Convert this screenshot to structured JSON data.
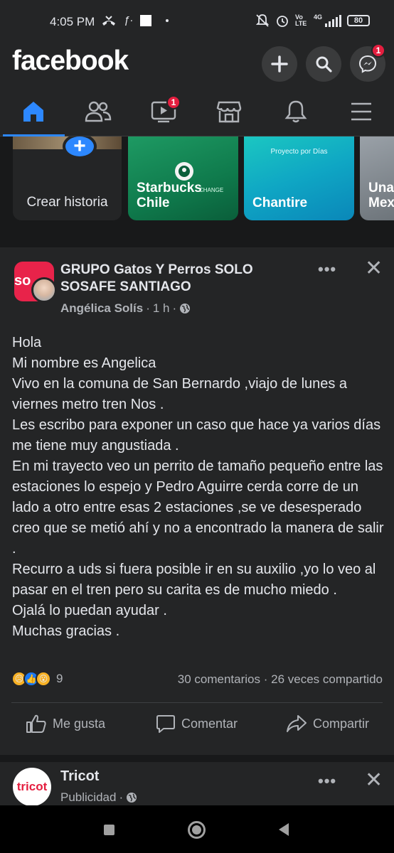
{
  "status_bar": {
    "time": "4:05 PM",
    "battery": "80",
    "network": "4G",
    "volte": "Vo LTE"
  },
  "header": {
    "logo": "facebook",
    "messenger_badge": "1"
  },
  "tabs": {
    "active": "home",
    "watch_badge": "1",
    "items": [
      "home-icon",
      "friends-icon",
      "watch-icon",
      "marketplace-icon",
      "notifications-icon",
      "menu-icon"
    ]
  },
  "stories": {
    "create_label": "Crear historia",
    "items": [
      {
        "name": "Starbucks Chile",
        "sub": ""
      },
      {
        "name": "Chantire",
        "sub": "Proyecto por Días"
      },
      {
        "name": "Una Mex",
        "sub": ""
      }
    ],
    "starbucks_overlay": "CHANGE"
  },
  "post": {
    "group_name": "GRUPO Gatos Y Perros SOLO SOSAFE SANTIAGO",
    "group_avatar_text": "so",
    "author": "Angélica Solís",
    "time": "1 h",
    "body": [
      "Hola",
      "Mi nombre es Angelica",
      "Vivo en la comuna de San Bernardo ,viajo de lunes a viernes metro tren Nos .",
      "Les escribo para exponer un caso que hace ya varios días me tiene muy angustiada .",
      "En mi trayecto veo un perrito de tamaño pequeño entre las estaciones lo espejo y Pedro Aguirre cerda corre de un lado a otro entre esas 2 estaciones ,se ve desesperado creo que se metió ahí y no a encontrado la manera de salir .",
      "Recurro a uds si fuera posible ir en su auxilio ,yo lo veo al pasar en el tren pero su carita es de mucho miedo .",
      "Ojalá lo puedan ayudar .",
      "Muchas gracias ."
    ],
    "reaction_count": "9",
    "comments": "30 comentarios",
    "shares": "26 veces compartido",
    "actions": {
      "like": "Me gusta",
      "comment": "Comentar",
      "share": "Compartir"
    }
  },
  "ad": {
    "name": "Tricot",
    "avatar_text": "tricot",
    "label": "Publicidad"
  },
  "colors": {
    "accent": "#2d88ff",
    "badge": "#e41e3f",
    "background": "#18191a",
    "surface": "#242526"
  }
}
